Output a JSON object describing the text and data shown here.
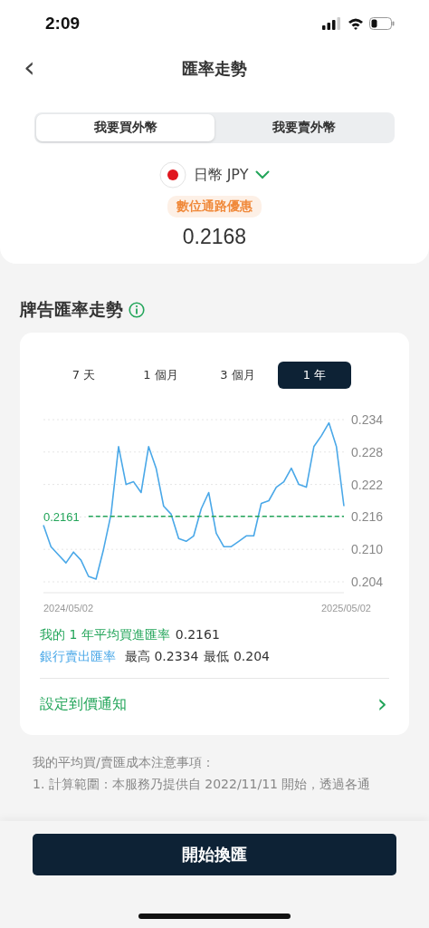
{
  "status_bar": {
    "time": "2:09"
  },
  "header": {
    "back": "‹",
    "title": "匯率走勢"
  },
  "trade_tabs": [
    {
      "label": "我要買外幣",
      "selected": true
    },
    {
      "label": "我要賣外幣",
      "selected": false
    }
  ],
  "currency": {
    "name": "日幣 JPY",
    "badge": "數位通路優惠",
    "rate": "0.2168"
  },
  "section_title": "牌告匯率走勢",
  "periods": [
    {
      "label": "7 天",
      "selected": false
    },
    {
      "label": "1 個月",
      "selected": false
    },
    {
      "label": "3 個月",
      "selected": false
    },
    {
      "label": "1 年",
      "selected": true
    }
  ],
  "chart": {
    "chart_data": {
      "type": "line",
      "ylim": [
        0.204,
        0.234
      ],
      "yticks": [
        {
          "value": 0.234,
          "label": "0.234"
        },
        {
          "value": 0.228,
          "label": "0.228"
        },
        {
          "value": 0.222,
          "label": "0.222"
        },
        {
          "value": 0.216,
          "label": "0.216"
        },
        {
          "value": 0.21,
          "label": "0.210"
        },
        {
          "value": 0.204,
          "label": "0.204"
        }
      ],
      "grid": true,
      "series": [
        {
          "name": "銀行賣出匯率",
          "color": "#4aa8e8",
          "values": [
            0.2145,
            0.2105,
            0.209,
            0.2075,
            0.2095,
            0.208,
            0.205,
            0.2045,
            0.21,
            0.2165,
            0.229,
            0.222,
            0.2225,
            0.2205,
            0.229,
            0.225,
            0.218,
            0.2165,
            0.212,
            0.2115,
            0.2125,
            0.2175,
            0.2205,
            0.213,
            0.2105,
            0.2105,
            0.2115,
            0.2125,
            0.2125,
            0.2185,
            0.219,
            0.2215,
            0.2225,
            0.225,
            0.222,
            0.2215,
            0.229,
            0.231,
            0.2334,
            0.229,
            0.218
          ]
        },
        {
          "name": "我的 1 年平均買進匯率",
          "color": "#23a55a",
          "line_style": "dashed",
          "values": [
            null,
            null,
            null,
            null,
            null,
            null,
            0.2161,
            0.2161,
            0.2161,
            0.2161,
            0.2161,
            0.2161,
            0.2161,
            0.2161,
            0.2161,
            0.2161,
            0.2161,
            0.2161,
            0.2161,
            0.2161,
            0.2161,
            0.2161,
            0.2161,
            0.2161,
            0.2161,
            0.2161,
            0.2161,
            0.2161,
            0.2161,
            0.2161,
            0.2161,
            0.2161,
            0.2161,
            0.2161,
            0.2161,
            0.2161,
            0.2161,
            0.2161,
            0.2161,
            0.2161,
            0.2161
          ]
        }
      ]
    },
    "average_label": "0.2161",
    "x_start_label": "2024/05/02",
    "x_end_label": "2025/05/02"
  },
  "stats": {
    "avg_value": "0.2161",
    "high": "最高 0.2334",
    "low": "最低 0.204"
  },
  "alert_link": {
    "label": "設定到價通知",
    "chevron": "›"
  },
  "notes": [
    "我的平均買/賣匯成本注意事項：",
    "1. 計算範圍：本服務乃提供自 2022/11/11 開始，透過各通"
  ],
  "primary_button": "開始換匯"
}
